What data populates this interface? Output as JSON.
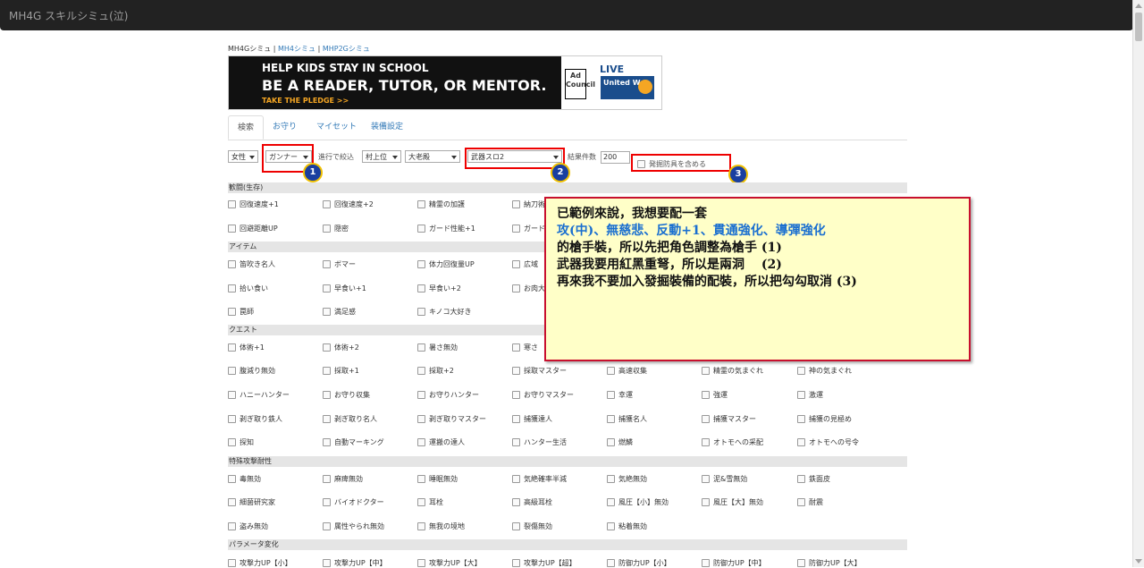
{
  "navbar": {
    "title": "MH4G スキルシミュ(泣)"
  },
  "simlinks": {
    "current": "MH4Gシミュ",
    "link1": "MH4シミュ",
    "link2": "MHP2Gシミュ",
    "sep": "|"
  },
  "banner": {
    "line1": "HELP KIDS STAY IN SCHOOL",
    "line2": "BE A READER, TUTOR, OR MENTOR.",
    "line3": "TAKE THE PLEDGE >>",
    "adcouncil": "Ad Council",
    "liveunited": "LIVE UNITED",
    "unitedway": "United Way"
  },
  "tabs": [
    "検索",
    "お守り",
    "マイセット",
    "装備設定"
  ],
  "filters": {
    "gender": "女性",
    "weapon_class": "ガンナー",
    "sort_label": "進行で絞込",
    "village": "村上位",
    "rank": "大老殿",
    "slots": "武器スロ2",
    "count_label": "結果件数",
    "count": "200",
    "include_label": "発掘防具を含める"
  },
  "badges": [
    "1",
    "2",
    "3"
  ],
  "sections": [
    {
      "name": "歓闘(生存)",
      "rows": [
        [
          "回復速度+1",
          "回復速度+2",
          "精霊の加護",
          "納刀術"
        ],
        [
          "回避距離UP",
          "隠密",
          "ガード性能+1",
          "ガード"
        ]
      ]
    },
    {
      "name": "アイテム",
      "rows": [
        [
          "笛吹き名人",
          "ボマー",
          "体力回復量UP",
          "広域"
        ],
        [
          "拾い食い",
          "早食い+1",
          "早食い+2",
          "お肉大"
        ],
        [
          "罠師",
          "満足感",
          "キノコ大好き"
        ]
      ]
    },
    {
      "name": "クエスト",
      "rows": [
        [
          "体術+1",
          "体術+2",
          "暑さ無効",
          "寒さ"
        ],
        [
          "腹減り無効",
          "採取+1",
          "採取+2",
          "採取マスター",
          "高速収集",
          "精霊の気まぐれ",
          "神の気まぐれ"
        ],
        [
          "ハニーハンター",
          "お守り収集",
          "お守りハンター",
          "お守りマスター",
          "幸運",
          "強運",
          "激運"
        ],
        [
          "剥ぎ取り鉄人",
          "剥ぎ取り名人",
          "剥ぎ取りマスター",
          "捕獲達人",
          "捕獲名人",
          "捕獲マスター",
          "捕獲の見極め"
        ],
        [
          "探知",
          "自動マーキング",
          "運搬の達人",
          "ハンター生活",
          "燃鱗",
          "オトモへの采配",
          "オトモへの号令"
        ]
      ]
    },
    {
      "name": "特殊攻撃耐性",
      "rows": [
        [
          "毒無効",
          "麻痺無効",
          "睡眠無効",
          "気絶確率半減",
          "気絶無効",
          "泥&雪無効",
          "鉄面皮"
        ],
        [
          "細菌研究家",
          "バイオドクター",
          "耳栓",
          "高級耳栓",
          "風圧【小】無効",
          "風圧【大】無効",
          "耐震"
        ],
        [
          "盗み無効",
          "属性やられ無効",
          "無我の境地",
          "裂傷無効",
          "粘着無効"
        ]
      ]
    },
    {
      "name": "パラメータ変化",
      "rows": [
        [
          "攻撃力UP【小】",
          "攻撃力UP【中】",
          "攻撃力UP【大】",
          "攻撃力UP【超】",
          "防御力UP【小】",
          "防御力UP【中】",
          "防御力UP【大】"
        ]
      ]
    }
  ],
  "note": {
    "line1": "已範例來說，我想要配一套",
    "line2": "攻(中)、無慈悲、反動+1、貫通強化、導彈強化",
    "line3": "的槍手裝，所以先把角色調整為槍手 (1)",
    "line4": "武器我要用紅黑重弩，所以是兩洞　 (2)",
    "line5": "再來我不要加入發掘裝備的配裝，所以把勾勾取消 (3)"
  },
  "colors": {
    "navbar": "#222222",
    "link": "#337ab7",
    "annotation_border": "#e00000",
    "note_bg": "#ffffc8",
    "highlight_text": "#1a6fd0"
  }
}
